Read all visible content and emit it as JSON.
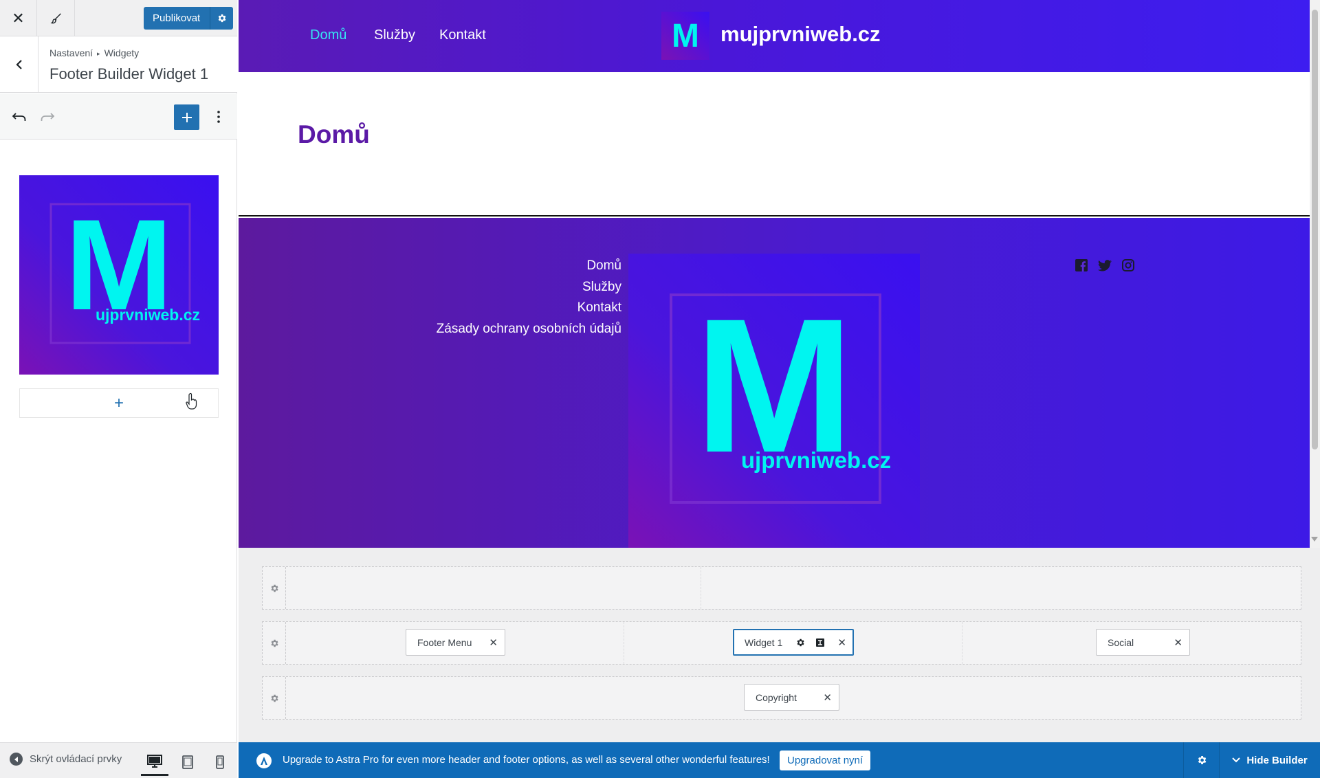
{
  "topbar": {
    "close_icon": "close-icon",
    "customize_icon": "brush-icon",
    "publish_label": "Publikovat",
    "publish_settings_icon": "gear-icon"
  },
  "section": {
    "breadcrumb": [
      "Nastavení",
      "Widgety"
    ],
    "title": "Footer Builder Widget 1"
  },
  "widget_image": {
    "letter": "M",
    "caption": "ujprvniweb.cz"
  },
  "sidebar_footer": {
    "collapse_label": "Skrýt ovládací prvky",
    "devices": [
      "desktop",
      "tablet",
      "mobile"
    ],
    "active_device": "desktop"
  },
  "site": {
    "nav": [
      "Domů",
      "Služby",
      "Kontakt"
    ],
    "active_nav": "Domů",
    "logo_letter": "M",
    "title": "mujprvniweb.cz",
    "page_title": "Domů",
    "footer_menu": [
      "Domů",
      "Služby",
      "Kontakt",
      "Zásady ochrany osobních údajů"
    ],
    "footer_logo_caption": "ujprvniweb.cz",
    "social": [
      "facebook-icon",
      "twitter-icon",
      "instagram-icon"
    ]
  },
  "builder": {
    "rows": [
      {
        "chips": []
      },
      {
        "chips": [
          "Footer Menu",
          "Widget 1",
          "Social"
        ]
      },
      {
        "chips": [
          "Copyright"
        ]
      }
    ],
    "chip_footer_menu": "Footer Menu",
    "chip_widget1": "Widget 1",
    "chip_social": "Social",
    "chip_copyright": "Copyright",
    "remove_glyph": "✕"
  },
  "bottom_bar": {
    "message": "Upgrade to Astra Pro for even more header and footer options, as well as several other wonderful features!",
    "upgrade_label": "Upgradovat nyní",
    "hide_builder_label": "Hide Builder"
  },
  "colors": {
    "accent": "#2271b1",
    "bottom_bar": "#0f6bb8",
    "brand_purple": "#5b1aa6",
    "logo_cyan": "#00f5f0"
  }
}
